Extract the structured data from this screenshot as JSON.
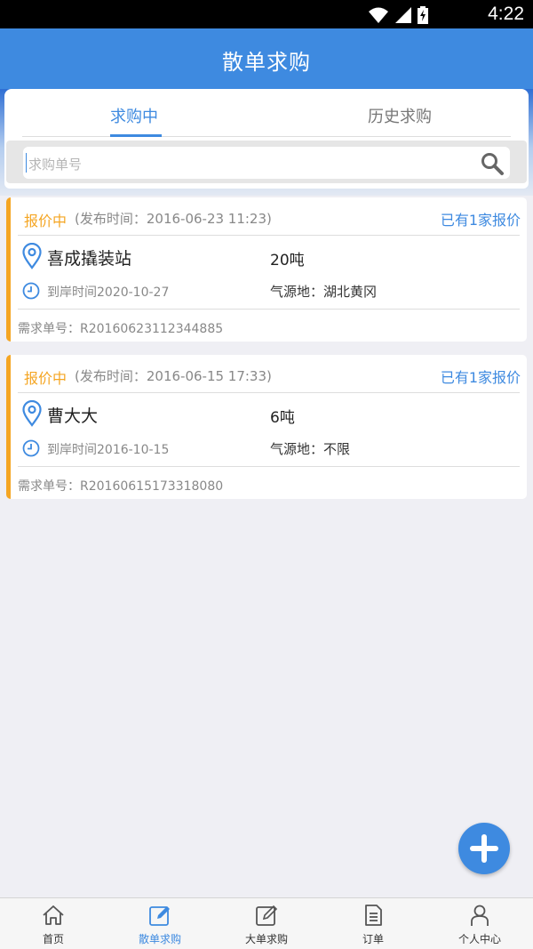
{
  "status_bar": {
    "time": "4:22"
  },
  "app_bar": {
    "title": "散单求购"
  },
  "tabs": [
    {
      "label": "求购中",
      "active": true
    },
    {
      "label": "历史求购",
      "active": false
    }
  ],
  "search": {
    "placeholder": "求购单号",
    "icon": "search-icon"
  },
  "orders": [
    {
      "status": "报价中",
      "publish_time": "(发布时间：2016-06-23 11:23)",
      "quotes": "已有1家报价",
      "station": "喜成撬装站",
      "quantity": "20吨",
      "arrival": "到岸时间2020-10-27",
      "origin": "气源地：湖北黄冈",
      "order_no": "需求单号：R20160623112344885"
    },
    {
      "status": "报价中",
      "publish_time": "(发布时间：2016-06-15 17:33)",
      "quotes": "已有1家报价",
      "station": "曹大大",
      "quantity": "6吨",
      "arrival": "到岸时间2016-10-15",
      "origin": "气源地：不限",
      "order_no": "需求单号：R20160615173318080"
    }
  ],
  "bottom_nav": [
    {
      "label": "首页",
      "icon": "home-icon",
      "active": false
    },
    {
      "label": "散单求购",
      "icon": "edit-icon",
      "active": true
    },
    {
      "label": "大单求购",
      "icon": "edit-icon",
      "active": false
    },
    {
      "label": "订单",
      "icon": "document-icon",
      "active": false
    },
    {
      "label": "个人中心",
      "icon": "person-icon",
      "active": false
    }
  ],
  "colors": {
    "primary": "#3e8ae0",
    "pending": "#f5a623"
  }
}
